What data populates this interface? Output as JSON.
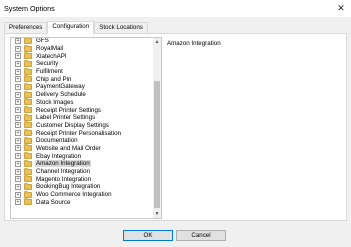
{
  "window": {
    "title": "System Options",
    "close_glyph": "✕"
  },
  "tabs": [
    {
      "label": "Preferences",
      "active": false
    },
    {
      "label": "Configuration",
      "active": true
    },
    {
      "label": "Stock Locations",
      "active": false
    }
  ],
  "tree": {
    "expander_glyph": "+",
    "selected": "Amazon Integration",
    "items": [
      {
        "label": "GFS"
      },
      {
        "label": "RoyalMail"
      },
      {
        "label": "XlatechAPI"
      },
      {
        "label": "Security"
      },
      {
        "label": "Fulfilment"
      },
      {
        "label": "Chip and Pin"
      },
      {
        "label": "PaymentGateway"
      },
      {
        "label": "Delivery Schedule"
      },
      {
        "label": "Stock Images"
      },
      {
        "label": "Receipt Printer Settings"
      },
      {
        "label": "Label Printer Settings"
      },
      {
        "label": "Customer Display Settings"
      },
      {
        "label": "Receipt Printer Personalisation"
      },
      {
        "label": "Documentation"
      },
      {
        "label": "Website and Mail Order"
      },
      {
        "label": "Ebay Integration"
      },
      {
        "label": "Amazon Integration"
      },
      {
        "label": "Channel Integration"
      },
      {
        "label": "Magento Integration"
      },
      {
        "label": "BookingBug Integration"
      },
      {
        "label": "Woo Commerce Integration"
      },
      {
        "label": "Data Source"
      }
    ]
  },
  "scrollbar": {
    "up_glyph": "▲",
    "down_glyph": "▼"
  },
  "detail": {
    "heading": "Amazon Integration"
  },
  "buttons": {
    "ok": "OK",
    "cancel": "Cancel"
  },
  "icons": {
    "folder": "folder-icon",
    "expander": "expand-plus-icon",
    "close": "close-icon"
  }
}
